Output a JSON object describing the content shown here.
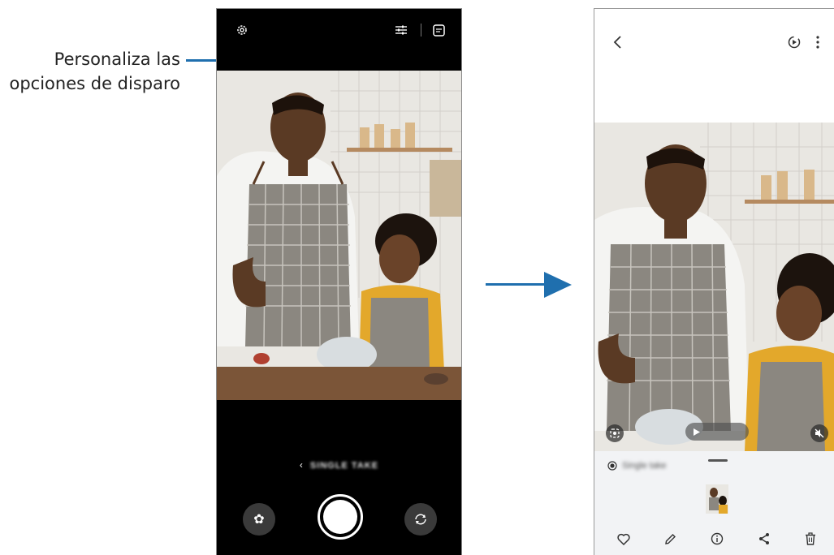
{
  "callout": {
    "line1": "Personaliza las",
    "line2": "opciones de disparo"
  },
  "colors": {
    "accent_blue": "#1f6fae",
    "camera_bg": "#000000",
    "gallery_panel": "#f2f3f5"
  },
  "camera": {
    "top_icons": [
      "gear-icon",
      "sliders-icon",
      "chat-icon"
    ],
    "mode_label": "SINGLE TAKE",
    "bottom_icons": [
      "filter-flower-icon",
      "shutter-button",
      "switch-camera-icon"
    ]
  },
  "gallery": {
    "top_icons": [
      "back-icon",
      "remaster-icon",
      "more-icon"
    ],
    "clip_label": "Single take",
    "bottom_icons": [
      "heart-icon",
      "pencil-icon",
      "info-icon",
      "share-icon",
      "trash-icon"
    ]
  }
}
